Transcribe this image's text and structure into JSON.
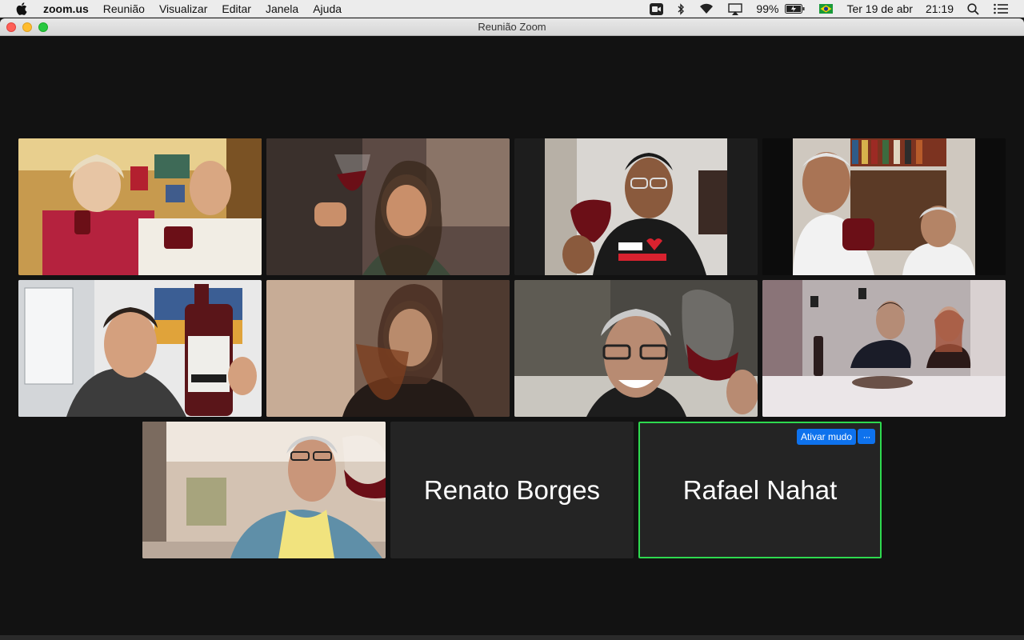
{
  "menubar": {
    "app_name": "zoom.us",
    "menus": [
      "Reunião",
      "Visualizar",
      "Editar",
      "Janela",
      "Ajuda"
    ],
    "battery": "99%",
    "datetime": "Ter 19 de abr",
    "time": "21:19"
  },
  "window": {
    "title": "Reunião Zoom"
  },
  "participants": {
    "renato": {
      "name": "Renato Borges"
    },
    "rafael": {
      "name": "Rafael Nahat",
      "mute_label": "Ativar mudo",
      "more_label": "···"
    }
  },
  "colors": {
    "accent": "#0e72ed",
    "active_speaker_border": "#2ed94f",
    "wine": "#6b0f17"
  }
}
